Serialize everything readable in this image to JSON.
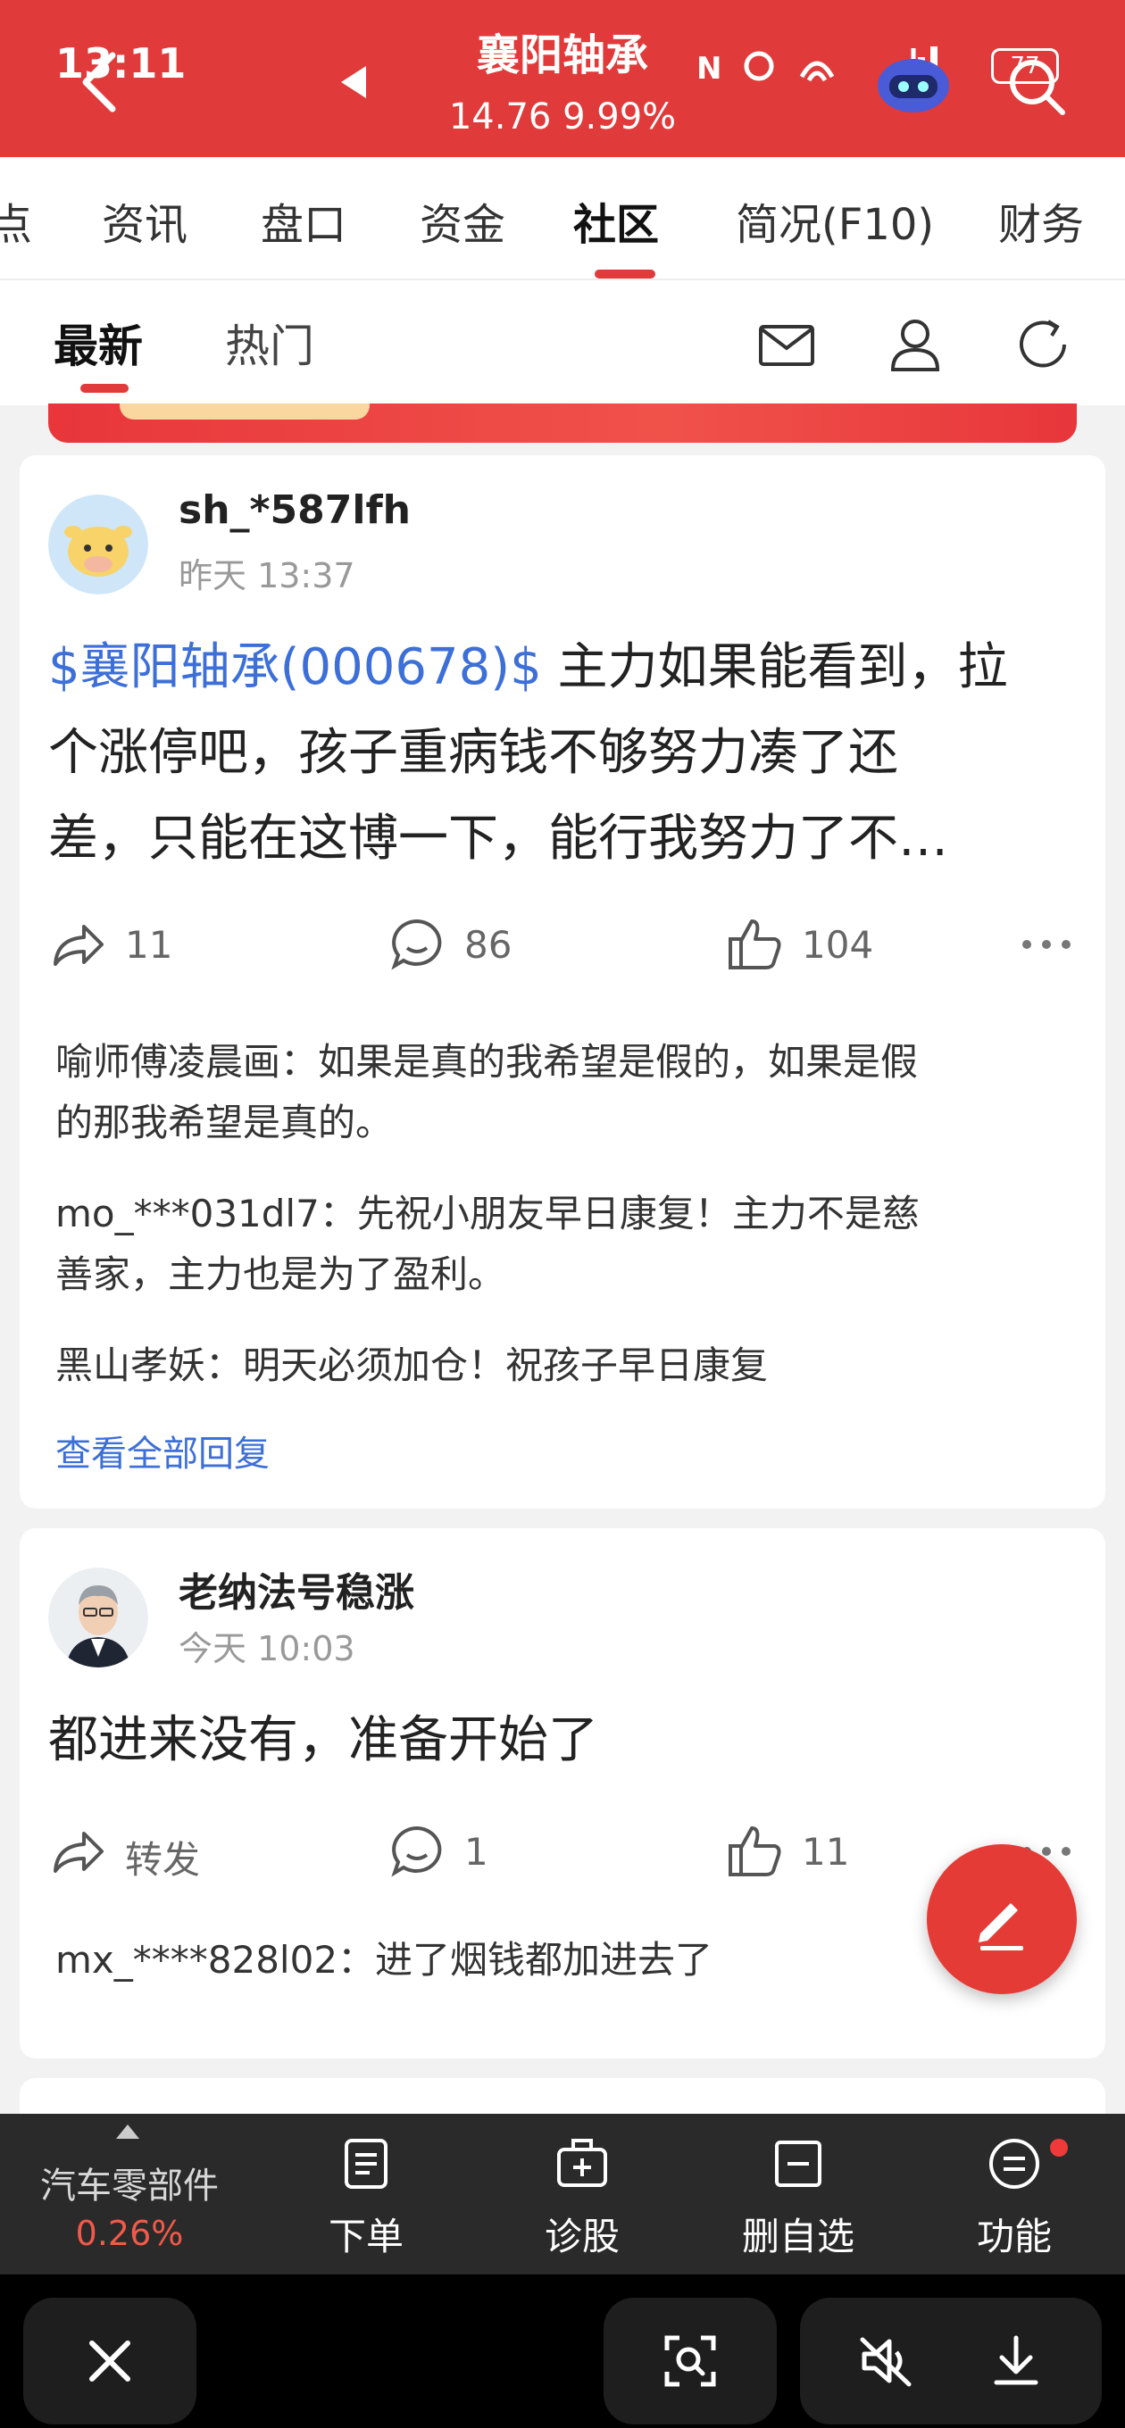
{
  "status_bar": {
    "time": "13:11",
    "battery": "77"
  },
  "header": {
    "title": "襄阳轴承",
    "price": "14.76",
    "change_pct": "9.99%"
  },
  "stock_tabs": [
    "点",
    "资讯",
    "盘口",
    "资金",
    "社区",
    "简况(F10)",
    "财务"
  ],
  "stock_tab_active": "社区",
  "community_tabs": {
    "latest": "最新",
    "hot": "热门"
  },
  "posts": [
    {
      "username": "sh_*587lfh",
      "time": "昨天 13:37",
      "stock_tag": "$襄阳轴承(000678)$",
      "line1": " 主力如果能看到，拉",
      "line2": "个涨停吧，孩子重病钱不够努力凑了还",
      "line3": "差，只能在这博一下，能行我努力了不…",
      "shares": "11",
      "comments": "86",
      "likes": "104",
      "replies": [
        {
          "user": "喻师傅凌晨画",
          "line1": "：如果是真的我希望是假的，如果是假",
          "line2": "的那我希望是真的。"
        },
        {
          "user": "mo_***031dl7",
          "line1": "：先祝小朋友早日康复！主力不是慈",
          "line2": "善家，主力也是为了盈利。"
        },
        {
          "user": "黑山孝妖",
          "line1": "：明天必须加仓！祝孩子早日康复",
          "line2": ""
        }
      ],
      "view_all": "查看全部回复"
    },
    {
      "username": "老纳法号稳涨",
      "time": "今天 10:03",
      "body": "都进来没有，准备开始了",
      "shares": "转发",
      "comments": "1",
      "likes": "11",
      "replies": [
        {
          "user": "mx_****828l02",
          "line1": "：进了烟钱都加进去了"
        }
      ]
    }
  ],
  "toolbar": {
    "sector_name": "汽车零部件",
    "sector_change": "0.26%",
    "order": "下单",
    "diagnose": "诊股",
    "remove_watch": "删自选",
    "functions": "功能"
  },
  "colors": {
    "brand_red": "#e03a3a",
    "link_blue": "#3d6fd8",
    "toolbar_bg": "#2a2a2a"
  }
}
